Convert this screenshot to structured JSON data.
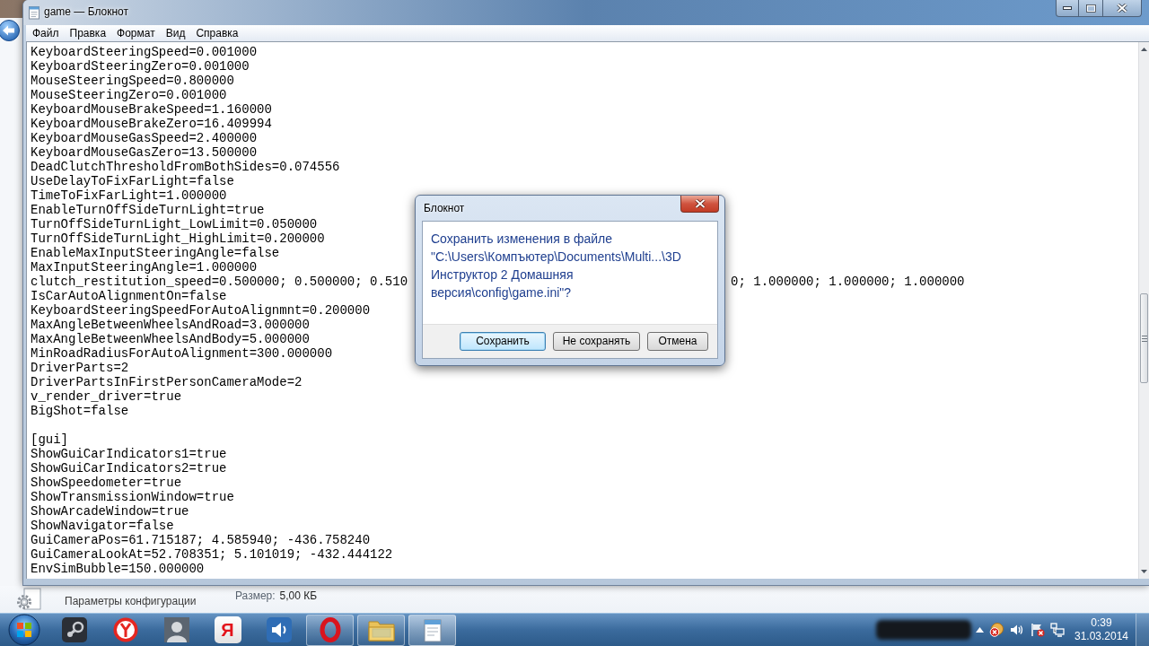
{
  "window": {
    "title": "game — Блокнот",
    "menu": [
      "Файл",
      "Правка",
      "Формат",
      "Вид",
      "Справка"
    ]
  },
  "document": {
    "lines": [
      {
        "kind": "text",
        "text": "KeyboardSteeringSpeed=0.001000"
      },
      {
        "kind": "text",
        "text": "KeyboardSteeringZero=0.001000"
      },
      {
        "kind": "text",
        "text": "MouseSteeringSpeed=0.800000"
      },
      {
        "kind": "text",
        "text": "MouseSteeringZero=0.001000"
      },
      {
        "kind": "text",
        "text": "KeyboardMouseBrakeSpeed=1.160000"
      },
      {
        "kind": "text",
        "text": "KeyboardMouseBrakeZero=16.409994"
      },
      {
        "kind": "text",
        "text": "KeyboardMouseGasSpeed=2.400000"
      },
      {
        "kind": "text",
        "text": "KeyboardMouseGasZero=13.500000"
      },
      {
        "kind": "text",
        "text": "DeadClutchThresholdFromBothSides=0.074556"
      },
      {
        "kind": "text",
        "text": "UseDelayToFixFarLight=false"
      },
      {
        "kind": "text",
        "text": "TimeToFixFarLight=1.000000"
      },
      {
        "kind": "text",
        "text": "EnableTurnOffSideTurnLight=true"
      },
      {
        "kind": "text",
        "text": "TurnOffSideTurnLight_LowLimit=0.050000"
      },
      {
        "kind": "text",
        "text": "TurnOffSideTurnLight_HighLimit=0.200000"
      },
      {
        "kind": "text",
        "text": "EnableMaxInputSteeringAngle=false"
      },
      {
        "kind": "text",
        "text": "MaxInputSteeringAngle=1.000000"
      },
      {
        "kind": "covered",
        "parts": [
          "clutch_restitution_speed=0.500000; 0.500000; 0.510",
          "0; 1.000000; 1.000000; 1.000000"
        ]
      },
      {
        "kind": "text",
        "text": "IsCarAutoAlignmentOn=false"
      },
      {
        "kind": "text",
        "text": "KeyboardSteeringSpeedForAutoAlignmnt=0.200000"
      },
      {
        "kind": "text",
        "text": "MaxAngleBetweenWheelsAndRoad=3.000000"
      },
      {
        "kind": "text",
        "text": "MaxAngleBetweenWheelsAndBody=5.000000"
      },
      {
        "kind": "text",
        "text": "MinRoadRadiusForAutoAlignment=300.000000"
      },
      {
        "kind": "text",
        "text": "DriverParts=2"
      },
      {
        "kind": "text",
        "text": "DriverPartsInFirstPersonCameraMode=2"
      },
      {
        "kind": "text",
        "text": "v_render_driver=true"
      },
      {
        "kind": "text",
        "text": "BigShot=false"
      },
      {
        "kind": "blank"
      },
      {
        "kind": "text",
        "text": "[gui]"
      },
      {
        "kind": "text",
        "text": "ShowGuiCarIndicators1=true"
      },
      {
        "kind": "text",
        "text": "ShowGuiCarIndicators2=true"
      },
      {
        "kind": "text",
        "text": "ShowSpeedometer=true"
      },
      {
        "kind": "text",
        "text": "ShowTransmissionWindow=true"
      },
      {
        "kind": "text",
        "text": "ShowArcadeWindow=true"
      },
      {
        "kind": "text",
        "text": "ShowNavigator=false"
      },
      {
        "kind": "text",
        "text": "GuiCameraPos=61.715187; 4.585940; -436.758240"
      },
      {
        "kind": "text",
        "text": "GuiCameraLookAt=52.708351; 5.101019; -432.444122"
      },
      {
        "kind": "text",
        "text": "EnvSimBubble=150.000000"
      }
    ]
  },
  "dialog": {
    "title": "Блокнот",
    "message": "Сохранить изменения в файле \"C:\\Users\\Компъютер\\Documents\\Multi...\\3D Инструктор 2 Домашняя версия\\config\\game.ini\"?",
    "buttons": [
      {
        "label": "Сохранить",
        "selected": true
      },
      {
        "label": "Не сохранять",
        "selected": false
      },
      {
        "label": "Отмена",
        "selected": false
      }
    ]
  },
  "details_pane": {
    "file_type": "Параметры конфигурации",
    "size_label": "Размер:",
    "size_value": "5,00 КБ"
  },
  "taskbar": {
    "buttons": [
      {
        "kind": "piston",
        "running": false,
        "active": false
      },
      {
        "kind": "fork",
        "running": false,
        "active": false
      },
      {
        "kind": "avatar",
        "running": false,
        "active": false
      },
      {
        "kind": "letter",
        "letter": "Я",
        "running": false,
        "active": false
      },
      {
        "kind": "speaker",
        "running": false,
        "active": false
      },
      {
        "kind": "ring",
        "running": true,
        "active": false
      },
      {
        "kind": "folder",
        "running": true,
        "active": false
      },
      {
        "kind": "notepad",
        "running": true,
        "active": true
      }
    ],
    "clock": {
      "time": "0:39",
      "date": "31.03.2014"
    }
  }
}
